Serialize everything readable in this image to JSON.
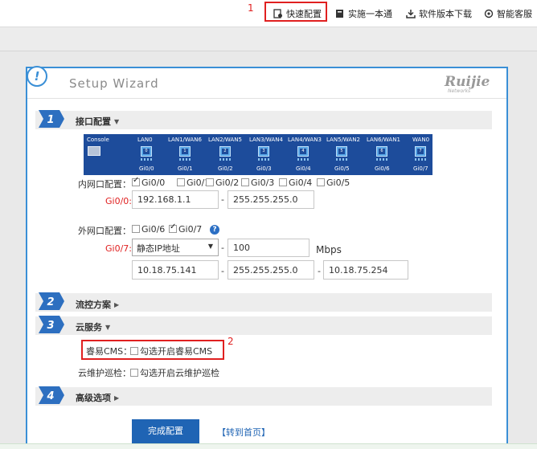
{
  "topbar": {
    "quick_config": "快速配置",
    "one_stop": "实施一本通",
    "download": "软件版本下载",
    "service": "智能客服",
    "annotation_1": "1"
  },
  "panel": {
    "title": "Setup Wizard",
    "logo": "Ruijie",
    "logo_sub": "Networks"
  },
  "steps": [
    {
      "num": "1",
      "title": "接口配置",
      "expanded": true
    },
    {
      "num": "2",
      "title": "流控方案",
      "expanded": false
    },
    {
      "num": "3",
      "title": "云服务",
      "expanded": true
    },
    {
      "num": "4",
      "title": "高级选项",
      "expanded": false
    }
  ],
  "ports": {
    "console": "Console",
    "labels": [
      "LAN0",
      "LAN1/WAN6",
      "LAN2/WAN5",
      "LAN3/WAN4",
      "LAN4/WAN3",
      "LAN5/WAN2",
      "LAN6/WAN1",
      "WAN0"
    ],
    "names": [
      "Gi0/0",
      "Gi0/1",
      "Gi0/2",
      "Gi0/3",
      "Gi0/4",
      "Gi0/5",
      "Gi0/6",
      "Gi0/7"
    ],
    "numbers": [
      "0",
      "1",
      "2",
      "3",
      "4",
      "5",
      "6",
      "7"
    ]
  },
  "lan": {
    "label": "内网口配置：",
    "options": [
      {
        "label": "Gi0/0",
        "checked": true
      },
      {
        "label": "Gi0/1",
        "checked": false
      },
      {
        "label": "Gi0/2",
        "checked": false
      },
      {
        "label": "Gi0/3",
        "checked": false
      },
      {
        "label": "Gi0/4",
        "checked": false
      },
      {
        "label": "Gi0/5",
        "checked": false
      }
    ],
    "iface_label": "Gi0/0:",
    "ip": "192.168.1.1",
    "mask": "255.255.255.0"
  },
  "wan": {
    "label": "外网口配置：",
    "options": [
      {
        "label": "Gi0/6",
        "checked": false
      },
      {
        "label": "Gi0/7",
        "checked": true
      }
    ],
    "iface_label": "Gi0/7:",
    "mode": "静态IP地址",
    "bandwidth": "100",
    "unit": "Mbps",
    "ip": "10.18.75.141",
    "mask": "255.255.255.0",
    "gateway": "10.18.75.254",
    "help": "?"
  },
  "cloud": {
    "cms_label": "睿易CMS：",
    "cms_option": "勾选开启睿易CMS",
    "patrol_label": "云维护巡检：",
    "patrol_option": "勾选开启云维护巡检",
    "annotation_2": "2"
  },
  "actions": {
    "finish": "完成配置",
    "home": "【转到首页】"
  }
}
